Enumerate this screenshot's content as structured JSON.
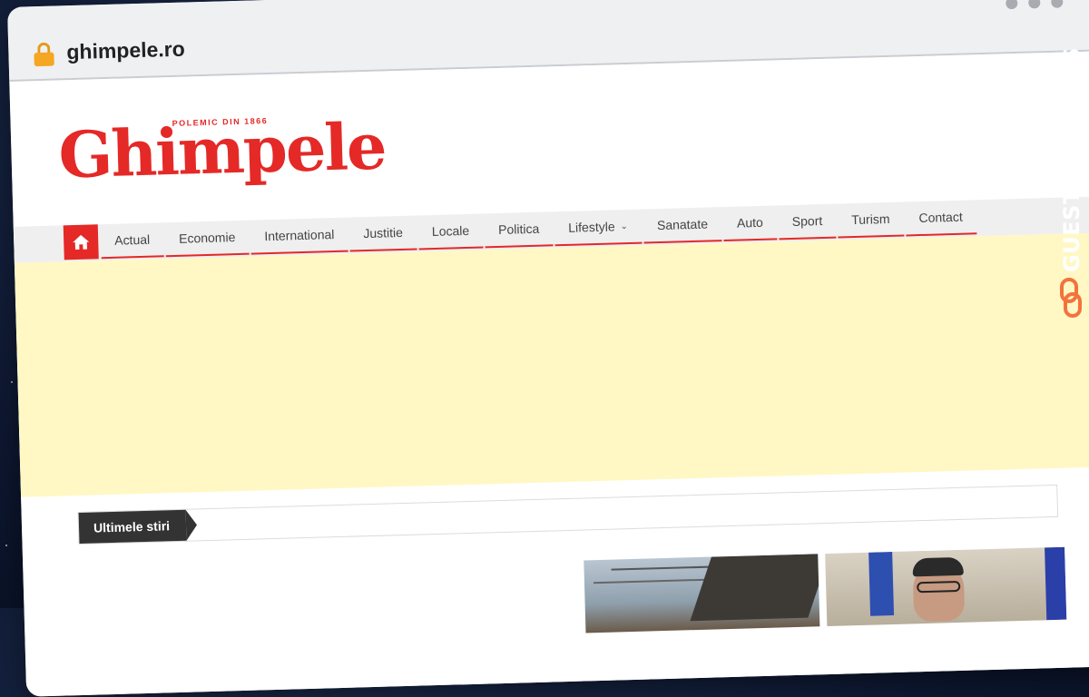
{
  "browser": {
    "url": "ghimpele.ro"
  },
  "site": {
    "logo_text": "Ghimpele",
    "logo_tagline": "POLEMIC DIN 1866"
  },
  "nav": {
    "items": [
      {
        "label": "Actual"
      },
      {
        "label": "Economie"
      },
      {
        "label": "International"
      },
      {
        "label": "Justitie"
      },
      {
        "label": "Locale"
      },
      {
        "label": "Politica"
      },
      {
        "label": "Lifestyle",
        "has_dropdown": true
      },
      {
        "label": "Sanatate"
      },
      {
        "label": "Auto"
      },
      {
        "label": "Sport"
      },
      {
        "label": "Turism"
      },
      {
        "label": "Contact"
      }
    ]
  },
  "ticker": {
    "label": "Ultimele stiri"
  },
  "watermark": {
    "text": "GUESTPOSTLINKS"
  },
  "colors": {
    "brand_red": "#e42927",
    "ad_background": "#fff8c5",
    "ticker_dark": "#333333",
    "watermark_orange": "#f4733d"
  },
  "icons": {
    "home": "home-icon",
    "lock": "lock-icon",
    "dropdown": "chevron-down-icon",
    "watermark": "chain-link-icon"
  }
}
